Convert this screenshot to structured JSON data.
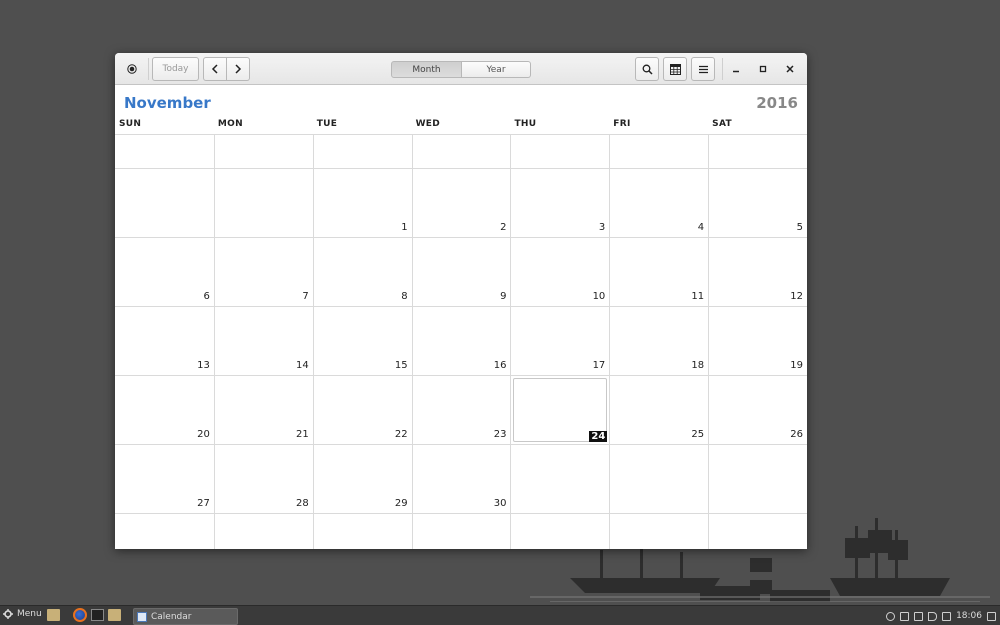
{
  "toolbar": {
    "today_label": "Today",
    "month_tab": "Month",
    "year_tab": "Year"
  },
  "calendar": {
    "month": "November",
    "year": "2016",
    "weekdays": [
      "SUN",
      "MON",
      "TUE",
      "WED",
      "THU",
      "FRI",
      "SAT"
    ],
    "today": "24",
    "weeks": [
      [
        "",
        "",
        "",
        "",
        "",
        "",
        ""
      ],
      [
        "",
        "",
        "1",
        "2",
        "3",
        "4",
        "5"
      ],
      [
        "6",
        "7",
        "8",
        "9",
        "10",
        "11",
        "12"
      ],
      [
        "13",
        "14",
        "15",
        "16",
        "17",
        "18",
        "19"
      ],
      [
        "20",
        "21",
        "22",
        "23",
        "24",
        "25",
        "26"
      ],
      [
        "27",
        "28",
        "29",
        "30",
        "",
        "",
        ""
      ],
      [
        "",
        "",
        "",
        "",
        "",
        "",
        ""
      ]
    ]
  },
  "taskbar": {
    "menu_label": "Menu",
    "window_label": "Calendar",
    "clock": "18:06"
  },
  "icons": {
    "record": "record-icon",
    "back": "chevron-left-icon",
    "forward": "chevron-right-icon",
    "search": "search-icon",
    "calendar_list": "calendar-list-icon",
    "menu": "hamburger-menu-icon",
    "minimize": "minimize-icon",
    "maximize": "maximize-icon",
    "close": "close-icon"
  },
  "colors": {
    "month_title": "#3878c8",
    "year_title": "#888888",
    "today_badge": "#111111"
  }
}
